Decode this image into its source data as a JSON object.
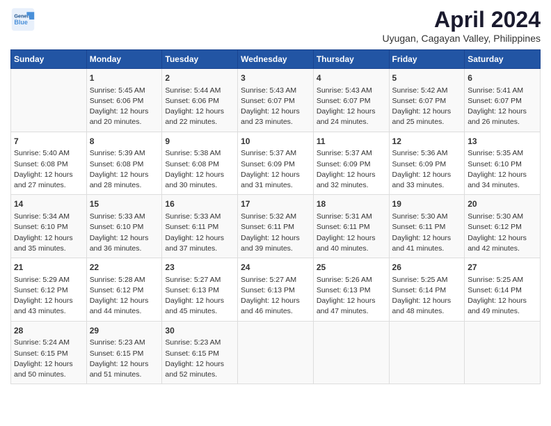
{
  "header": {
    "logo_general": "General",
    "logo_blue": "Blue",
    "title": "April 2024",
    "subtitle": "Uyugan, Cagayan Valley, Philippines"
  },
  "columns": [
    "Sunday",
    "Monday",
    "Tuesday",
    "Wednesday",
    "Thursday",
    "Friday",
    "Saturday"
  ],
  "weeks": [
    [
      {
        "day": "",
        "lines": []
      },
      {
        "day": "1",
        "lines": [
          "Sunrise: 5:45 AM",
          "Sunset: 6:06 PM",
          "Daylight: 12 hours",
          "and 20 minutes."
        ]
      },
      {
        "day": "2",
        "lines": [
          "Sunrise: 5:44 AM",
          "Sunset: 6:06 PM",
          "Daylight: 12 hours",
          "and 22 minutes."
        ]
      },
      {
        "day": "3",
        "lines": [
          "Sunrise: 5:43 AM",
          "Sunset: 6:07 PM",
          "Daylight: 12 hours",
          "and 23 minutes."
        ]
      },
      {
        "day": "4",
        "lines": [
          "Sunrise: 5:43 AM",
          "Sunset: 6:07 PM",
          "Daylight: 12 hours",
          "and 24 minutes."
        ]
      },
      {
        "day": "5",
        "lines": [
          "Sunrise: 5:42 AM",
          "Sunset: 6:07 PM",
          "Daylight: 12 hours",
          "and 25 minutes."
        ]
      },
      {
        "day": "6",
        "lines": [
          "Sunrise: 5:41 AM",
          "Sunset: 6:07 PM",
          "Daylight: 12 hours",
          "and 26 minutes."
        ]
      }
    ],
    [
      {
        "day": "7",
        "lines": [
          "Sunrise: 5:40 AM",
          "Sunset: 6:08 PM",
          "Daylight: 12 hours",
          "and 27 minutes."
        ]
      },
      {
        "day": "8",
        "lines": [
          "Sunrise: 5:39 AM",
          "Sunset: 6:08 PM",
          "Daylight: 12 hours",
          "and 28 minutes."
        ]
      },
      {
        "day": "9",
        "lines": [
          "Sunrise: 5:38 AM",
          "Sunset: 6:08 PM",
          "Daylight: 12 hours",
          "and 30 minutes."
        ]
      },
      {
        "day": "10",
        "lines": [
          "Sunrise: 5:37 AM",
          "Sunset: 6:09 PM",
          "Daylight: 12 hours",
          "and 31 minutes."
        ]
      },
      {
        "day": "11",
        "lines": [
          "Sunrise: 5:37 AM",
          "Sunset: 6:09 PM",
          "Daylight: 12 hours",
          "and 32 minutes."
        ]
      },
      {
        "day": "12",
        "lines": [
          "Sunrise: 5:36 AM",
          "Sunset: 6:09 PM",
          "Daylight: 12 hours",
          "and 33 minutes."
        ]
      },
      {
        "day": "13",
        "lines": [
          "Sunrise: 5:35 AM",
          "Sunset: 6:10 PM",
          "Daylight: 12 hours",
          "and 34 minutes."
        ]
      }
    ],
    [
      {
        "day": "14",
        "lines": [
          "Sunrise: 5:34 AM",
          "Sunset: 6:10 PM",
          "Daylight: 12 hours",
          "and 35 minutes."
        ]
      },
      {
        "day": "15",
        "lines": [
          "Sunrise: 5:33 AM",
          "Sunset: 6:10 PM",
          "Daylight: 12 hours",
          "and 36 minutes."
        ]
      },
      {
        "day": "16",
        "lines": [
          "Sunrise: 5:33 AM",
          "Sunset: 6:11 PM",
          "Daylight: 12 hours",
          "and 37 minutes."
        ]
      },
      {
        "day": "17",
        "lines": [
          "Sunrise: 5:32 AM",
          "Sunset: 6:11 PM",
          "Daylight: 12 hours",
          "and 39 minutes."
        ]
      },
      {
        "day": "18",
        "lines": [
          "Sunrise: 5:31 AM",
          "Sunset: 6:11 PM",
          "Daylight: 12 hours",
          "and 40 minutes."
        ]
      },
      {
        "day": "19",
        "lines": [
          "Sunrise: 5:30 AM",
          "Sunset: 6:11 PM",
          "Daylight: 12 hours",
          "and 41 minutes."
        ]
      },
      {
        "day": "20",
        "lines": [
          "Sunrise: 5:30 AM",
          "Sunset: 6:12 PM",
          "Daylight: 12 hours",
          "and 42 minutes."
        ]
      }
    ],
    [
      {
        "day": "21",
        "lines": [
          "Sunrise: 5:29 AM",
          "Sunset: 6:12 PM",
          "Daylight: 12 hours",
          "and 43 minutes."
        ]
      },
      {
        "day": "22",
        "lines": [
          "Sunrise: 5:28 AM",
          "Sunset: 6:12 PM",
          "Daylight: 12 hours",
          "and 44 minutes."
        ]
      },
      {
        "day": "23",
        "lines": [
          "Sunrise: 5:27 AM",
          "Sunset: 6:13 PM",
          "Daylight: 12 hours",
          "and 45 minutes."
        ]
      },
      {
        "day": "24",
        "lines": [
          "Sunrise: 5:27 AM",
          "Sunset: 6:13 PM",
          "Daylight: 12 hours",
          "and 46 minutes."
        ]
      },
      {
        "day": "25",
        "lines": [
          "Sunrise: 5:26 AM",
          "Sunset: 6:13 PM",
          "Daylight: 12 hours",
          "and 47 minutes."
        ]
      },
      {
        "day": "26",
        "lines": [
          "Sunrise: 5:25 AM",
          "Sunset: 6:14 PM",
          "Daylight: 12 hours",
          "and 48 minutes."
        ]
      },
      {
        "day": "27",
        "lines": [
          "Sunrise: 5:25 AM",
          "Sunset: 6:14 PM",
          "Daylight: 12 hours",
          "and 49 minutes."
        ]
      }
    ],
    [
      {
        "day": "28",
        "lines": [
          "Sunrise: 5:24 AM",
          "Sunset: 6:15 PM",
          "Daylight: 12 hours",
          "and 50 minutes."
        ]
      },
      {
        "day": "29",
        "lines": [
          "Sunrise: 5:23 AM",
          "Sunset: 6:15 PM",
          "Daylight: 12 hours",
          "and 51 minutes."
        ]
      },
      {
        "day": "30",
        "lines": [
          "Sunrise: 5:23 AM",
          "Sunset: 6:15 PM",
          "Daylight: 12 hours",
          "and 52 minutes."
        ]
      },
      {
        "day": "",
        "lines": []
      },
      {
        "day": "",
        "lines": []
      },
      {
        "day": "",
        "lines": []
      },
      {
        "day": "",
        "lines": []
      }
    ]
  ]
}
